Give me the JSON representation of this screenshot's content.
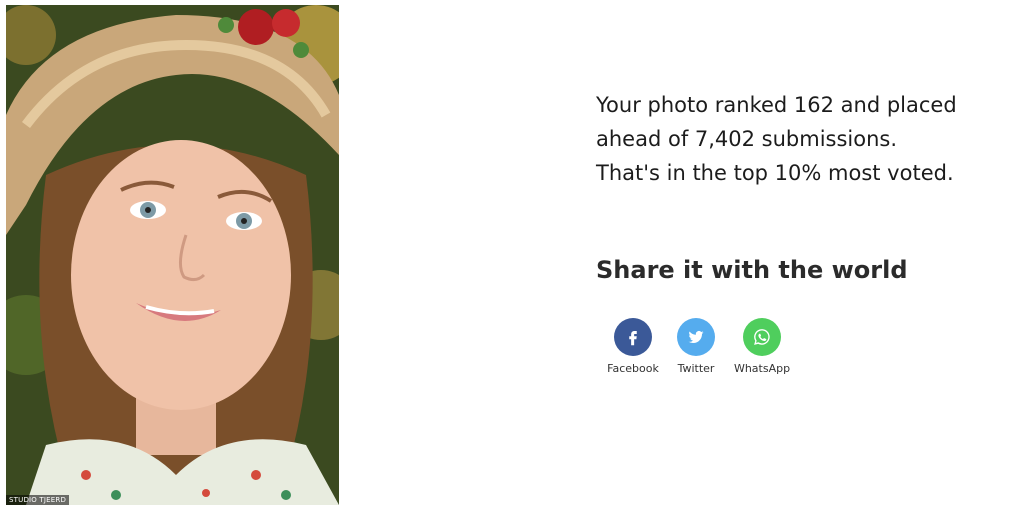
{
  "photo": {
    "credit": "STUDIO TJEERD"
  },
  "result": {
    "line1": "Your photo ranked 162 and placed",
    "line2": "ahead of 7,402 submissions.",
    "line3": "That's in the top 10% most voted."
  },
  "share": {
    "heading": "Share it with the world",
    "buttons": [
      {
        "label": "Facebook",
        "icon": "facebook-icon",
        "color": "#3b5998"
      },
      {
        "label": "Twitter",
        "icon": "twitter-icon",
        "color": "#55acee"
      },
      {
        "label": "WhatsApp",
        "icon": "whatsapp-icon",
        "color": "#4fce5d"
      }
    ]
  }
}
